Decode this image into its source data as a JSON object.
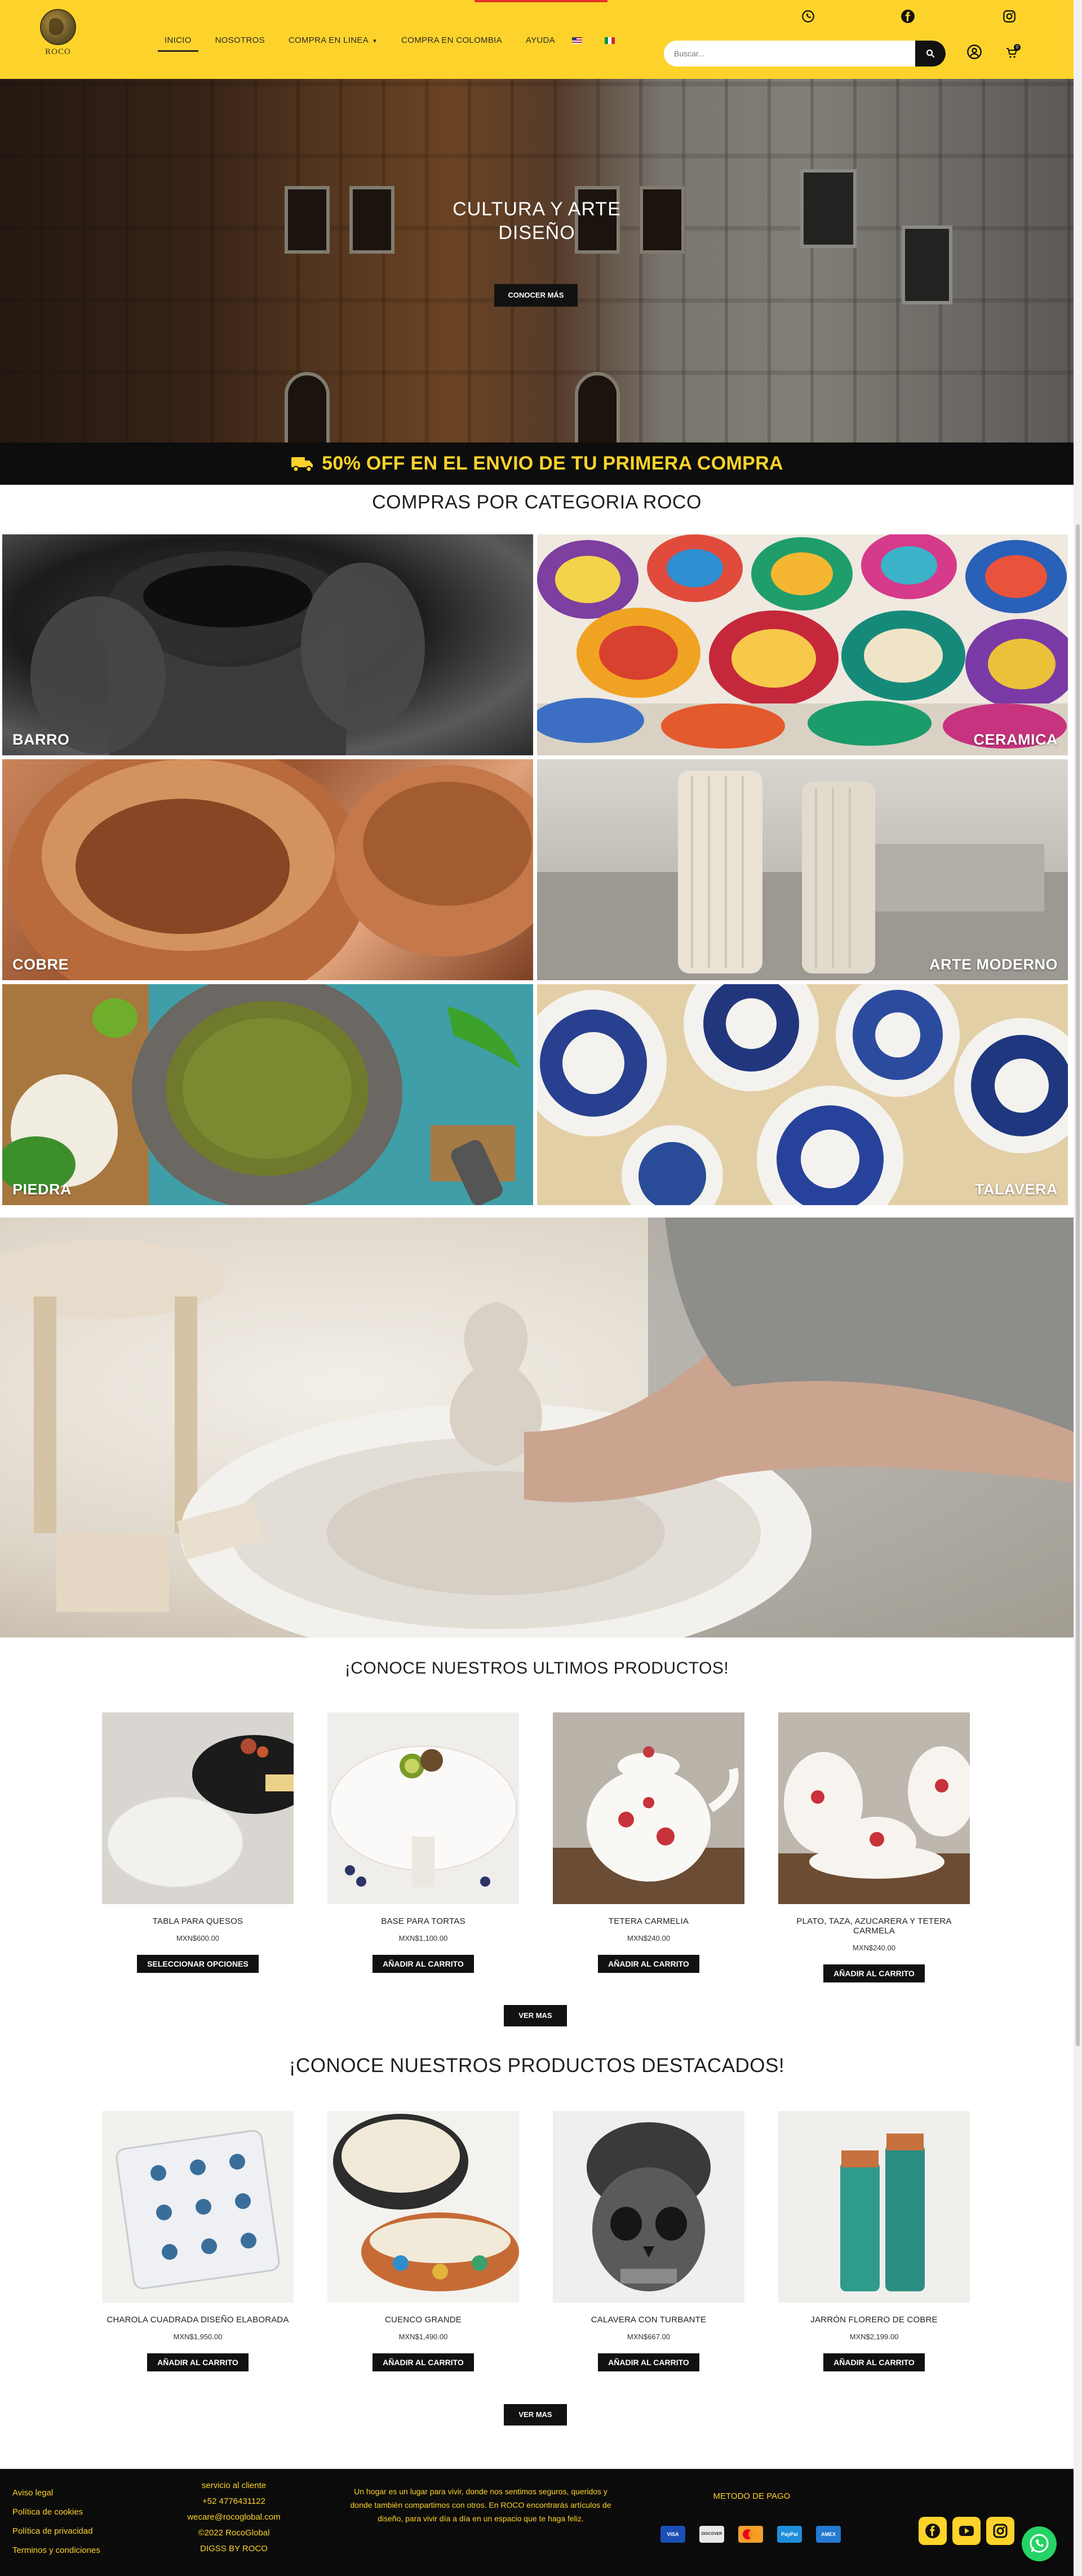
{
  "header": {
    "logo_text": "ROCO",
    "nav": [
      {
        "label": "INICIO",
        "active": true
      },
      {
        "label": "NOSOTROS"
      },
      {
        "label": "COMPRA EN LINEA",
        "has_dropdown": true
      },
      {
        "label": "COMPRA EN COLOMBIA"
      },
      {
        "label": "AYUDA"
      }
    ],
    "search_placeholder": "Buscar...",
    "cart_count": "0",
    "colors": {
      "bar": "#fdd32b",
      "dark": "#111111"
    }
  },
  "hero": {
    "title_line1": "CULTURA Y ARTE",
    "title_line2": "DISEÑO",
    "button": "CONOCER MÁS"
  },
  "promo": {
    "text": "50% OFF EN EL ENVIO DE TU PRIMERA COMPRA"
  },
  "categories": {
    "title": "COMPRAS POR CATEGORIA ROCO",
    "items": [
      "BARRO",
      "CERAMICA",
      "COBRE",
      "ARTE MODERNO",
      "PIEDRA",
      "TALAVERA"
    ]
  },
  "latest": {
    "title": "¡CONOCE NUESTROS ULTIMOS PRODUCTOS!",
    "products": [
      {
        "name": "TABLA PARA QUESOS",
        "price": "MXN$600.00",
        "button": "SELECCIONAR OPCIONES"
      },
      {
        "name": "BASE PARA TORTAS",
        "price": "MXN$1,100.00",
        "button": "AÑADIR AL CARRITO"
      },
      {
        "name": "TETERA CARMELIA",
        "price": "MXN$240.00",
        "button": "AÑADIR AL CARRITO"
      },
      {
        "name": "PLATO, TAZA, AZUCARERA Y TETERA CARMELA",
        "price": "MXN$240.00",
        "button": "AÑADIR AL CARRITO"
      }
    ],
    "more": "VER MAS"
  },
  "featured": {
    "title": "¡CONOCE NUESTROS PRODUCTOS DESTACADOS!",
    "products": [
      {
        "name": "CHAROLA CUADRADA DISEÑO ELABORADA",
        "price": "MXN$1,950.00",
        "button": "AÑADIR AL CARRITO"
      },
      {
        "name": "CUENCO GRANDE",
        "price": "MXN$1,490.00",
        "button": "AÑADIR AL CARRITO"
      },
      {
        "name": "CALAVERA CON TURBANTE",
        "price": "MXN$667.00",
        "button": "AÑADIR AL CARRITO"
      },
      {
        "name": "JARRÓN FLORERO DE COBRE",
        "price": "MXN$2,199.00",
        "button": "AÑADIR AL CARRITO"
      }
    ],
    "more": "VER MAS"
  },
  "footer": {
    "links": [
      "Aviso legal",
      "Política de cookies",
      "Política de privacidad",
      "Terminos y condiciones"
    ],
    "contact": [
      "servicio al cliente",
      "+52 4776431122",
      "wecare@rocoglobal.com",
      "©2022 RocoGlobal",
      "DIGSS BY ROCO"
    ],
    "about": "Un hogar es un lugar para vivir, donde nos sentimos seguros, queridos y donde también compartimos con otros. En ROCO encontrarás artículos de diseño, para vivir día a día en un espacio que te haga feliz.",
    "payment_title": "METODO DE PAGO",
    "payments": [
      "VISA",
      "DISCOVER",
      "MC",
      "PayPal",
      "AMEX"
    ]
  }
}
